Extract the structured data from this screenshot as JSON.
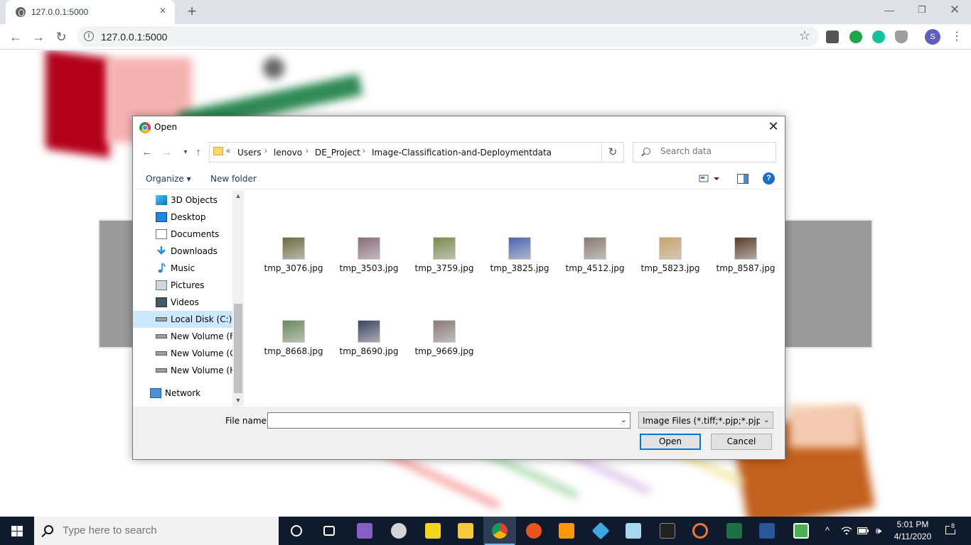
{
  "browser": {
    "tab_title": "127.0.0.1:5000",
    "url": "127.0.0.1:5000",
    "avatar_letter": "S"
  },
  "dialog": {
    "title": "Open",
    "breadcrumb_prefix": "«",
    "breadcrumb": [
      "Users",
      "lenovo",
      "DE_Project",
      "Image-Classification-and-Deployment",
      "data"
    ],
    "search_placeholder": "Search data",
    "organize_label": "Organize",
    "new_folder_label": "New folder",
    "help_label": "?",
    "nav_items": [
      {
        "label": "3D Objects",
        "icon": "3d-objects-icon"
      },
      {
        "label": "Desktop",
        "icon": "desktop-icon"
      },
      {
        "label": "Documents",
        "icon": "documents-icon"
      },
      {
        "label": "Downloads",
        "icon": "downloads-icon"
      },
      {
        "label": "Music",
        "icon": "music-icon"
      },
      {
        "label": "Pictures",
        "icon": "pictures-icon"
      },
      {
        "label": "Videos",
        "icon": "videos-icon"
      },
      {
        "label": "Local Disk (C:)",
        "icon": "drive-icon",
        "selected": true
      },
      {
        "label": "New Volume (F:)",
        "icon": "drive-icon"
      },
      {
        "label": "New Volume (G:)",
        "icon": "drive-icon"
      },
      {
        "label": "New Volume (H:)",
        "icon": "drive-icon"
      },
      {
        "label": "Network",
        "icon": "network-icon"
      }
    ],
    "files": [
      {
        "name": "tmp_3076.jpg",
        "color": "#6d6a3c"
      },
      {
        "name": "tmp_3503.jpg",
        "color": "#8a6c78"
      },
      {
        "name": "tmp_3759.jpg",
        "color": "#7a8a4a"
      },
      {
        "name": "tmp_3825.jpg",
        "color": "#4a64b0"
      },
      {
        "name": "tmp_4512.jpg",
        "color": "#8a7a70"
      },
      {
        "name": "tmp_5823.jpg",
        "color": "#c9a26a"
      },
      {
        "name": "tmp_8587.jpg",
        "color": "#5a3a2a"
      },
      {
        "name": "tmp_8668.jpg",
        "color": "#6a8a5a"
      },
      {
        "name": "tmp_8690.jpg",
        "color": "#3c4460"
      },
      {
        "name": "tmp_9669.jpg",
        "color": "#8a7a7a"
      }
    ],
    "file_name_label": "File name:",
    "file_name_value": "",
    "filter_value": "Image Files (*.tiff;*.pjp;*.pjpeg;*",
    "open_label": "Open",
    "cancel_label": "Cancel"
  },
  "taskbar": {
    "search_placeholder": "Type here to search",
    "time": "5:01 PM",
    "date": "4/11/2020",
    "notification_count": "8"
  }
}
